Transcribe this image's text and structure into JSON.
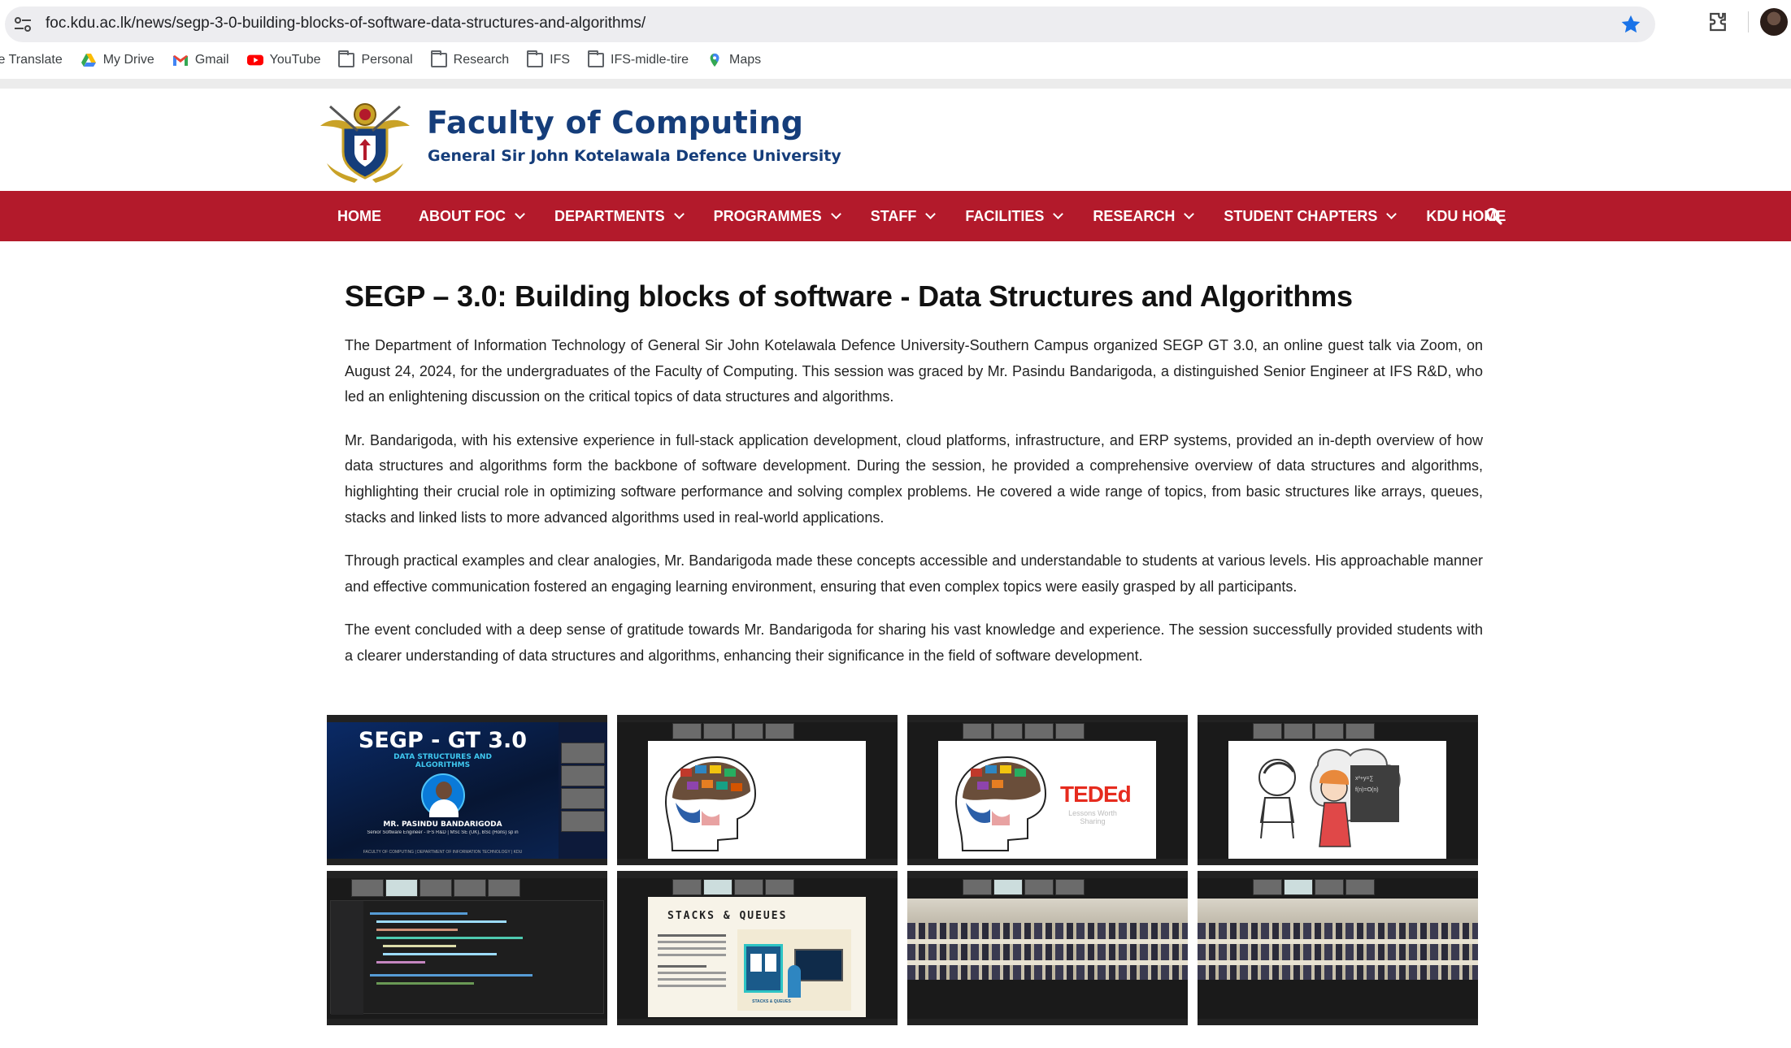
{
  "browser": {
    "url": "foc.kdu.ac.lk/news/segp-3-0-building-blocks-of-software-data-structures-and-algorithms/",
    "bookmarks": [
      {
        "label": "le Translate",
        "icon": "translate-icon"
      },
      {
        "label": "My Drive",
        "icon": "drive-icon"
      },
      {
        "label": "Gmail",
        "icon": "gmail-icon"
      },
      {
        "label": "YouTube",
        "icon": "youtube-icon"
      },
      {
        "label": "Personal",
        "icon": "folder-icon"
      },
      {
        "label": "Research",
        "icon": "folder-icon"
      },
      {
        "label": "IFS",
        "icon": "folder-icon"
      },
      {
        "label": "IFS-midle-tire",
        "icon": "folder-icon"
      },
      {
        "label": "Maps",
        "icon": "maps-icon"
      }
    ]
  },
  "site": {
    "title": "Faculty of Computing",
    "subtitle": "General Sir John Kotelawala Defence University",
    "brand_color": "#153d7a",
    "nav_color": "#b31a2b"
  },
  "nav": {
    "items": [
      {
        "label": "HOME",
        "dropdown": false
      },
      {
        "label": "ABOUT FOC",
        "dropdown": true
      },
      {
        "label": "DEPARTMENTS",
        "dropdown": true
      },
      {
        "label": "PROGRAMMES",
        "dropdown": true
      },
      {
        "label": "STAFF",
        "dropdown": true
      },
      {
        "label": "FACILITIES",
        "dropdown": true
      },
      {
        "label": "RESEARCH",
        "dropdown": true
      },
      {
        "label": "STUDENT CHAPTERS",
        "dropdown": true
      },
      {
        "label": "KDU HOME",
        "dropdown": false
      }
    ]
  },
  "article": {
    "title": "SEGP – 3.0: Building blocks of software - Data Structures and Algorithms",
    "paragraphs": [
      "The Department of Information Technology of General Sir John Kotelawala Defence University-Southern Campus organized SEGP GT 3.0, an online guest talk via Zoom, on August 24, 2024, for the undergraduates of the Faculty of Computing. This session was graced by Mr. Pasindu Bandarigoda, a distinguished Senior Engineer at IFS R&D, who led an enlightening discussion on the critical topics of data structures and algorithms.",
      "Mr. Bandarigoda, with his extensive experience in full-stack application development, cloud platforms, infrastructure, and ERP systems, provided an in-depth overview of how data structures and algorithms form the backbone of software development. During the session, he provided a comprehensive overview of data structures and algorithms, highlighting their crucial role in optimizing software performance and solving complex problems. He covered a wide range of topics, from basic structures like arrays, queues, stacks and linked lists to more advanced algorithms used in real-world applications.",
      "Through practical examples and clear analogies, Mr. Bandarigoda made these concepts accessible and understandable to students at various levels. His approachable manner and effective communication fostered an engaging learning environment, ensuring that even complex topics were easily grasped by all participants.",
      "The event concluded with a deep sense of gratitude towards Mr. Bandarigoda for sharing his vast knowledge and experience. The session successfully provided students with a clearer understanding of data structures and algorithms, enhancing their significance in the field of software development."
    ]
  },
  "gallery": {
    "poster_title": "SEGP - GT 3.0",
    "poster_subtitle": "DATA STRUCTURES AND ALGORITHMS",
    "poster_name": "MR. PASINDU BANDARIGODA",
    "poster_role": "Senior Software Engineer - IFS R&D  |  MSc SE (UK), BSc (Hons) sp in",
    "poster_footer": "FACULTY OF COMPUTING | DEPARTMENT OF INFORMATION TECHNOLOGY | KDU",
    "teded_label": "TEDEd",
    "teded_tag": "Lessons Worth Sharing",
    "stacks_title": "STACKS & QUEUES",
    "stacks_caption": "STACKS & QUEUES"
  }
}
